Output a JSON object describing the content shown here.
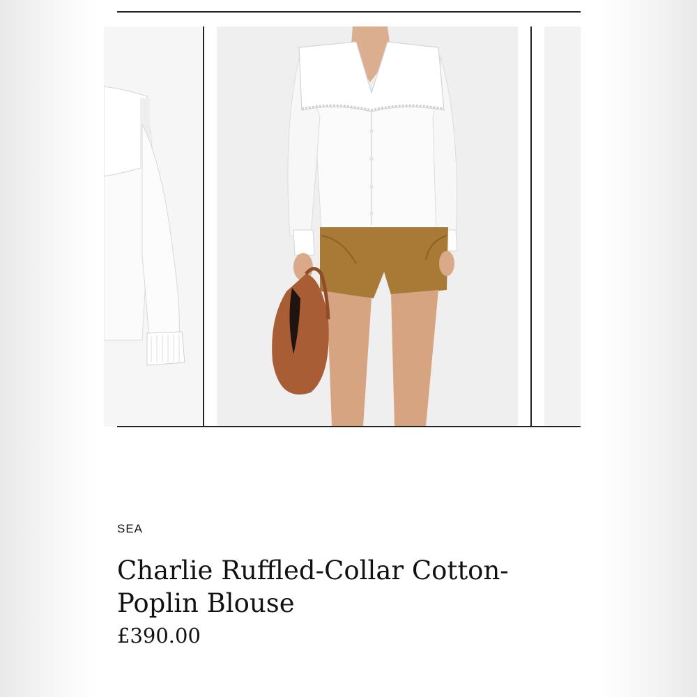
{
  "product": {
    "brand": "SEA",
    "title": "Charlie Ruffled-Collar Cotton-Poplin Blouse",
    "price": "£390.00"
  },
  "gallery": {
    "images": [
      {
        "name": "blouse-sleeve-detail"
      },
      {
        "name": "model-wearing-blouse-with-shorts-and-bag"
      },
      {
        "name": "next-image-partial"
      }
    ]
  },
  "colors": {
    "blouse": "#ffffff",
    "shorts": "#a97a36",
    "bag": "#a85d35",
    "skin": "#d9a98a",
    "rule": "#222222"
  }
}
